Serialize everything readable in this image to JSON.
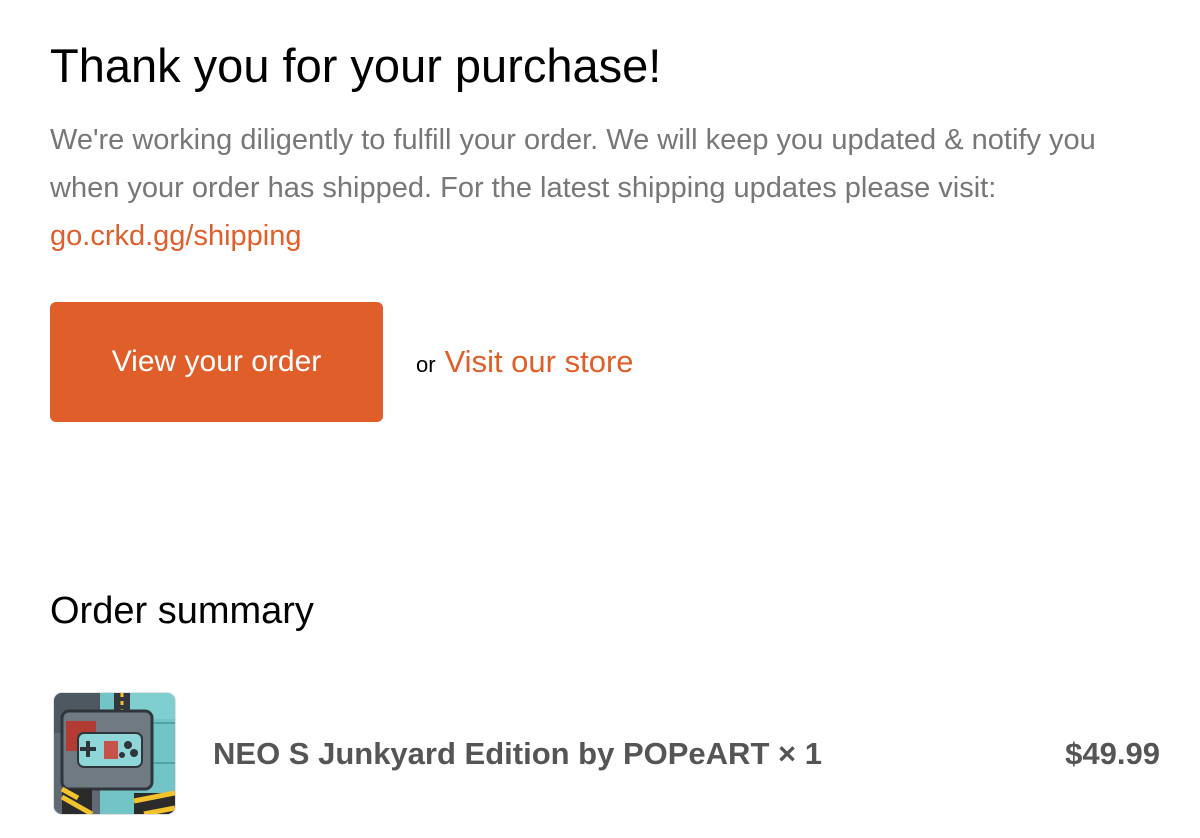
{
  "thank_you": {
    "heading": "Thank you for your purchase!",
    "message_text": "We're working diligently to fulfill your order. We will keep you updated & notify you when your order has shipped. For the latest shipping updates please visit:",
    "shipping_link": "go.crkd.gg/shipping"
  },
  "actions": {
    "view_order_label": "View your order",
    "or_text": "or",
    "visit_store_label": "Visit our store"
  },
  "order_summary": {
    "heading": "Order summary",
    "items": [
      {
        "title": "NEO S Junkyard Edition by POPeART × 1",
        "price": "$49.99",
        "thumbnail_icon": "neo-s-junkyard-controller-image"
      }
    ]
  },
  "colors": {
    "accent": "#E05E29",
    "body_text": "#777777",
    "heading_text": "#000000",
    "item_text": "#555555"
  }
}
